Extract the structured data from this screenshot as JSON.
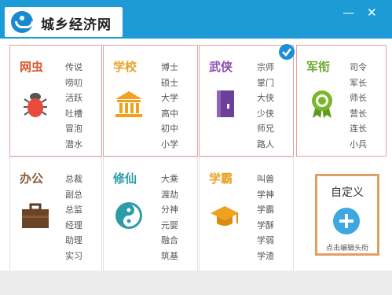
{
  "window": {
    "minimize_glyph": "—",
    "close_glyph": "✕"
  },
  "logo": {
    "text": "城乡经济网"
  },
  "categories": [
    {
      "name": "网虫",
      "color": "#d9532c",
      "icon": "bug-icon",
      "selected": false,
      "items": [
        "传说",
        "唠叨",
        "活跃",
        "吐槽",
        "冒泡",
        "潜水"
      ]
    },
    {
      "name": "学校",
      "color": "#e8a225",
      "icon": "school-building-icon",
      "selected": false,
      "items": [
        "博士",
        "硕士",
        "大学",
        "高中",
        "初中",
        "小学"
      ]
    },
    {
      "name": "武侠",
      "color": "#8e4fae",
      "icon": "book-icon",
      "selected": true,
      "items": [
        "宗师",
        "掌门",
        "大侠",
        "少侠",
        "师兄",
        "路人"
      ]
    },
    {
      "name": "军衔",
      "color": "#6aa62c",
      "icon": "medal-icon",
      "selected": false,
      "items": [
        "司令",
        "军长",
        "师长",
        "营长",
        "连长",
        "小兵"
      ]
    },
    {
      "name": "办公",
      "color": "#8a5a36",
      "icon": "briefcase-icon",
      "selected": false,
      "items": [
        "总裁",
        "副总",
        "总监",
        "经理",
        "助理",
        "实习"
      ]
    },
    {
      "name": "修仙",
      "color": "#2e9ba8",
      "icon": "yin-yang-icon",
      "selected": false,
      "items": [
        "大乘",
        "渡劫",
        "分神",
        "元婴",
        "融合",
        "筑基"
      ]
    },
    {
      "name": "学霸",
      "color": "#e8a225",
      "icon": "graduation-cap-icon",
      "selected": false,
      "items": [
        "叫兽",
        "学神",
        "学霸",
        "学酥",
        "学弱",
        "学渣"
      ]
    }
  ],
  "custom": {
    "title": "自定义",
    "hint": "点击编辑头衔"
  },
  "colors": {
    "titlebar": "#1d9bd6",
    "accent_blue": "#1e8fd6",
    "custom_border": "#e0a060"
  }
}
